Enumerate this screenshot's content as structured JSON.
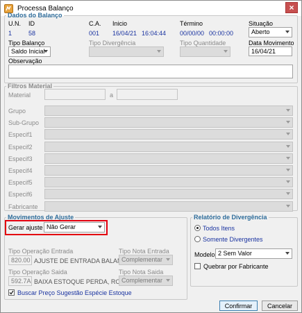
{
  "window": {
    "title": "Processa Balanço",
    "close_glyph": "×",
    "icon": "app-icon"
  },
  "dados": {
    "legend": "Dados do Balanço",
    "un_label": "U.N.",
    "un_value": "1",
    "id_label": "ID",
    "id_value": "58",
    "ca_label": "C.A.",
    "ca_value": "001",
    "inicio_label": "Inicio",
    "inicio_date": "16/04/21",
    "inicio_time": "16:04:44",
    "termino_label": "Término",
    "termino_date": "00/00/00",
    "termino_time": "00:00:00",
    "situacao_label": "Situação",
    "situacao_value": "Aberto",
    "tipo_balanco_label": "Tipo Balanço",
    "tipo_balanco_value": "Saldo Inicial",
    "tipo_divergencia_label": "Tipo Divergência",
    "tipo_quantidade_label": "Tipo Quantidade",
    "data_movimento_label": "Data Movimento",
    "data_movimento_value": "16/04/21",
    "observacao_label": "Observação"
  },
  "filtros": {
    "legend": "Filtros Material",
    "material_label": "Material",
    "a_label": "a",
    "rows": [
      "Grupo",
      "Sub-Grupo",
      "Especif1",
      "Especif2",
      "Especif3",
      "Especif4",
      "Especif5",
      "Especif6",
      "Fabricante"
    ]
  },
  "movimentos": {
    "legend": "Movimentos de Ajuste",
    "gerar_ajuste_label": "Gerar ajuste",
    "gerar_ajuste_value": "Não Gerar",
    "tipo_op_entrada_label": "Tipo Operação Entrada",
    "tipo_op_entrada_code": "820.00",
    "tipo_op_entrada_desc": "AJUSTE DE ENTRADA BALANCO",
    "tipo_nota_entrada_label": "Tipo Nota Entrada",
    "tipo_nota_entrada_value": "Complementar",
    "tipo_op_saida_label": "Tipo Operação Saida",
    "tipo_op_saida_code": "592.7A",
    "tipo_op_saida_desc": "BAIXA ESTOQUE PERDA, ROUBO",
    "tipo_nota_saida_label": "Tipo Nota Saida",
    "tipo_nota_saida_value": "Complementar",
    "buscar_preco_label": "Buscar Preço Sugestão Espécie Estoque",
    "buscar_preco_checked": true
  },
  "relatorio": {
    "legend": "Relatório de Divergência",
    "todos_label": "Todos Itens",
    "somente_label": "Somente Divergentes",
    "modelo_label": "Modelo",
    "modelo_value": "2 Sem Valor",
    "quebrar_label": "Quebrar por Fabricante"
  },
  "buttons": {
    "confirmar": "Confirmar",
    "cancelar": "Cancelar"
  },
  "colors": {
    "legend": "#2e6c9a",
    "blue_value": "#1a33a0",
    "highlight": "#e3000f"
  }
}
